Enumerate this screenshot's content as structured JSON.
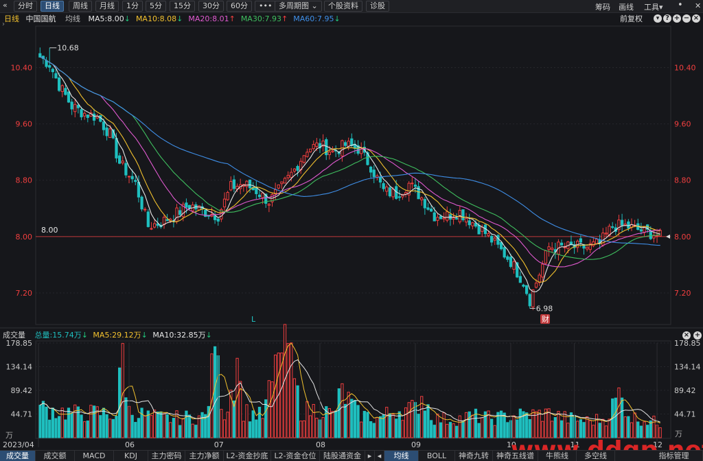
{
  "toolbar": {
    "back_icon": "back-chevron-icon",
    "buttons": [
      "分时",
      "日线",
      "周线",
      "月线",
      "1分",
      "5分",
      "15分",
      "30分",
      "60分",
      "•••",
      "多周期图",
      "个股资料",
      "诊股"
    ],
    "multi_period_arrow": "⌄",
    "right_items": [
      "筹码",
      "画线",
      "工具"
    ],
    "tools_arrow": "▾",
    "dot_icon": "dot-icon",
    "close_icon": "close-icon",
    "forward_icon": "forward-chevron-icon",
    "colors": {
      "active_bg": "#2c4d73",
      "bg": "#1f2024"
    }
  },
  "legend_top": {
    "period": "日线",
    "stock_name": "中国国航",
    "line_type": "均线",
    "items": [
      {
        "label": "MA5:8.00",
        "arrow": "↓",
        "color": "#e6e6e6",
        "arrow_color": "#21c77c"
      },
      {
        "label": "MA10:8.08",
        "arrow": "↓",
        "color": "#f2c12e",
        "arrow_color": "#21c77c"
      },
      {
        "label": "MA20:8.01",
        "arrow": "↑",
        "color": "#e05ad0",
        "arrow_color": "#f23f3f"
      },
      {
        "label": "MA30:7.93",
        "arrow": "↑",
        "color": "#3fbf5f",
        "arrow_color": "#f23f3f"
      },
      {
        "label": "MA60:7.95",
        "arrow": "↓",
        "color": "#3f8fe8",
        "arrow_color": "#21c77c"
      }
    ],
    "adjust": "前复权",
    "icons": [
      "adjust-dropdown-icon",
      "help-icon",
      "zoom-in-icon",
      "zoom-out-icon",
      "close-icon"
    ]
  },
  "price_axis": {
    "ticks": [
      "10.40",
      "9.60",
      "8.80",
      "8.00",
      "7.20"
    ],
    "current_price_line": "8.00",
    "high_label": "10.68",
    "low_label": "6.98",
    "marker_l": "L",
    "marker_cai": "财"
  },
  "volume_panel": {
    "title": "成交量",
    "total": "总量:15.74万",
    "total_arrow": "↓",
    "ma5": "MA5:29.12万",
    "ma5_arrow": "↓",
    "ma10": "MA10:32.85万",
    "ma10_arrow": "↓",
    "ticks": [
      "178.85",
      "134.14",
      "89.42",
      "44.71"
    ],
    "unit": "万",
    "icons": [
      "close-icon",
      "add-icon"
    ]
  },
  "date_axis": [
    "2023/04",
    "06",
    "07",
    "08",
    "09",
    "10",
    "11",
    "12"
  ],
  "bottom_tabs_left": [
    "成交量",
    "成交额",
    "MACD",
    "KDJ",
    "主力密码",
    "主力净额",
    "L2-资金抄底",
    "L2-资金仓位",
    "陆股通资金"
  ],
  "bottom_tabs_right": [
    "均线",
    "BOLL",
    "神奇九转",
    "神奇五线谱",
    "牛熊线",
    "多空线",
    "指标管理"
  ],
  "bottom_nav": {
    "left_icon": "tab-left-icon",
    "right_icon": "tab-right-icon"
  },
  "watermark": "www.ddgp.net",
  "colors": {
    "up": "#f23f3f",
    "down": "#1fbfbf",
    "ma5": "#e6e6e6",
    "ma10": "#f2c12e",
    "ma20": "#e05ad0",
    "ma30": "#3fbf5f",
    "ma60": "#3f8fe8",
    "watermark": "#d92626"
  },
  "chart_data": {
    "type": "candlestick",
    "y_range": [
      6.8,
      10.95
    ],
    "volume_range": [
      0,
      178.85
    ],
    "extremes": {
      "high": 10.68,
      "low": 6.98
    },
    "price_anchors": [
      [
        0,
        10.55
      ],
      [
        3,
        10.45
      ],
      [
        6,
        10.15
      ],
      [
        10,
        9.85
      ],
      [
        14,
        9.75
      ],
      [
        18,
        9.7
      ],
      [
        22,
        9.45
      ],
      [
        25,
        9.05
      ],
      [
        30,
        8.75
      ],
      [
        34,
        8.15
      ],
      [
        38,
        8.2
      ],
      [
        42,
        8.3
      ],
      [
        47,
        8.45
      ],
      [
        52,
        8.35
      ],
      [
        56,
        8.3
      ],
      [
        60,
        8.7
      ],
      [
        64,
        8.75
      ],
      [
        68,
        8.65
      ],
      [
        72,
        8.5
      ],
      [
        76,
        8.7
      ],
      [
        80,
        8.95
      ],
      [
        84,
        9.25
      ],
      [
        88,
        9.3
      ],
      [
        92,
        9.2
      ],
      [
        96,
        9.3
      ],
      [
        100,
        9.25
      ],
      [
        104,
        9.0
      ],
      [
        108,
        8.65
      ],
      [
        112,
        8.6
      ],
      [
        116,
        8.75
      ],
      [
        120,
        8.55
      ],
      [
        124,
        8.3
      ],
      [
        128,
        8.3
      ],
      [
        132,
        8.35
      ],
      [
        136,
        8.2
      ],
      [
        140,
        8.05
      ],
      [
        144,
        7.85
      ],
      [
        148,
        7.65
      ],
      [
        152,
        7.35
      ],
      [
        154,
        7.1
      ],
      [
        156,
        7.35
      ],
      [
        160,
        7.85
      ],
      [
        164,
        7.85
      ],
      [
        168,
        7.85
      ],
      [
        172,
        7.85
      ],
      [
        176,
        7.9
      ],
      [
        180,
        8.15
      ],
      [
        184,
        8.15
      ],
      [
        188,
        8.1
      ],
      [
        192,
        8.05
      ],
      [
        195,
        8.0
      ]
    ],
    "volume_anchors": [
      [
        0,
        62
      ],
      [
        6,
        55
      ],
      [
        12,
        50
      ],
      [
        18,
        52
      ],
      [
        24,
        48
      ],
      [
        26,
        178
      ],
      [
        28,
        55
      ],
      [
        34,
        45
      ],
      [
        40,
        40
      ],
      [
        46,
        42
      ],
      [
        52,
        44
      ],
      [
        55,
        172
      ],
      [
        58,
        48
      ],
      [
        62,
        150
      ],
      [
        64,
        55
      ],
      [
        70,
        45
      ],
      [
        75,
        160
      ],
      [
        78,
        178
      ],
      [
        82,
        55
      ],
      [
        88,
        60
      ],
      [
        92,
        48
      ],
      [
        95,
        95
      ],
      [
        100,
        50
      ],
      [
        106,
        40
      ],
      [
        112,
        58
      ],
      [
        118,
        60
      ],
      [
        120,
        89
      ],
      [
        124,
        40
      ],
      [
        130,
        38
      ],
      [
        136,
        45
      ],
      [
        142,
        40
      ],
      [
        148,
        45
      ],
      [
        154,
        48
      ],
      [
        160,
        50
      ],
      [
        166,
        40
      ],
      [
        172,
        35
      ],
      [
        178,
        40
      ],
      [
        182,
        90
      ],
      [
        186,
        42
      ],
      [
        190,
        38
      ],
      [
        195,
        30
      ]
    ]
  }
}
